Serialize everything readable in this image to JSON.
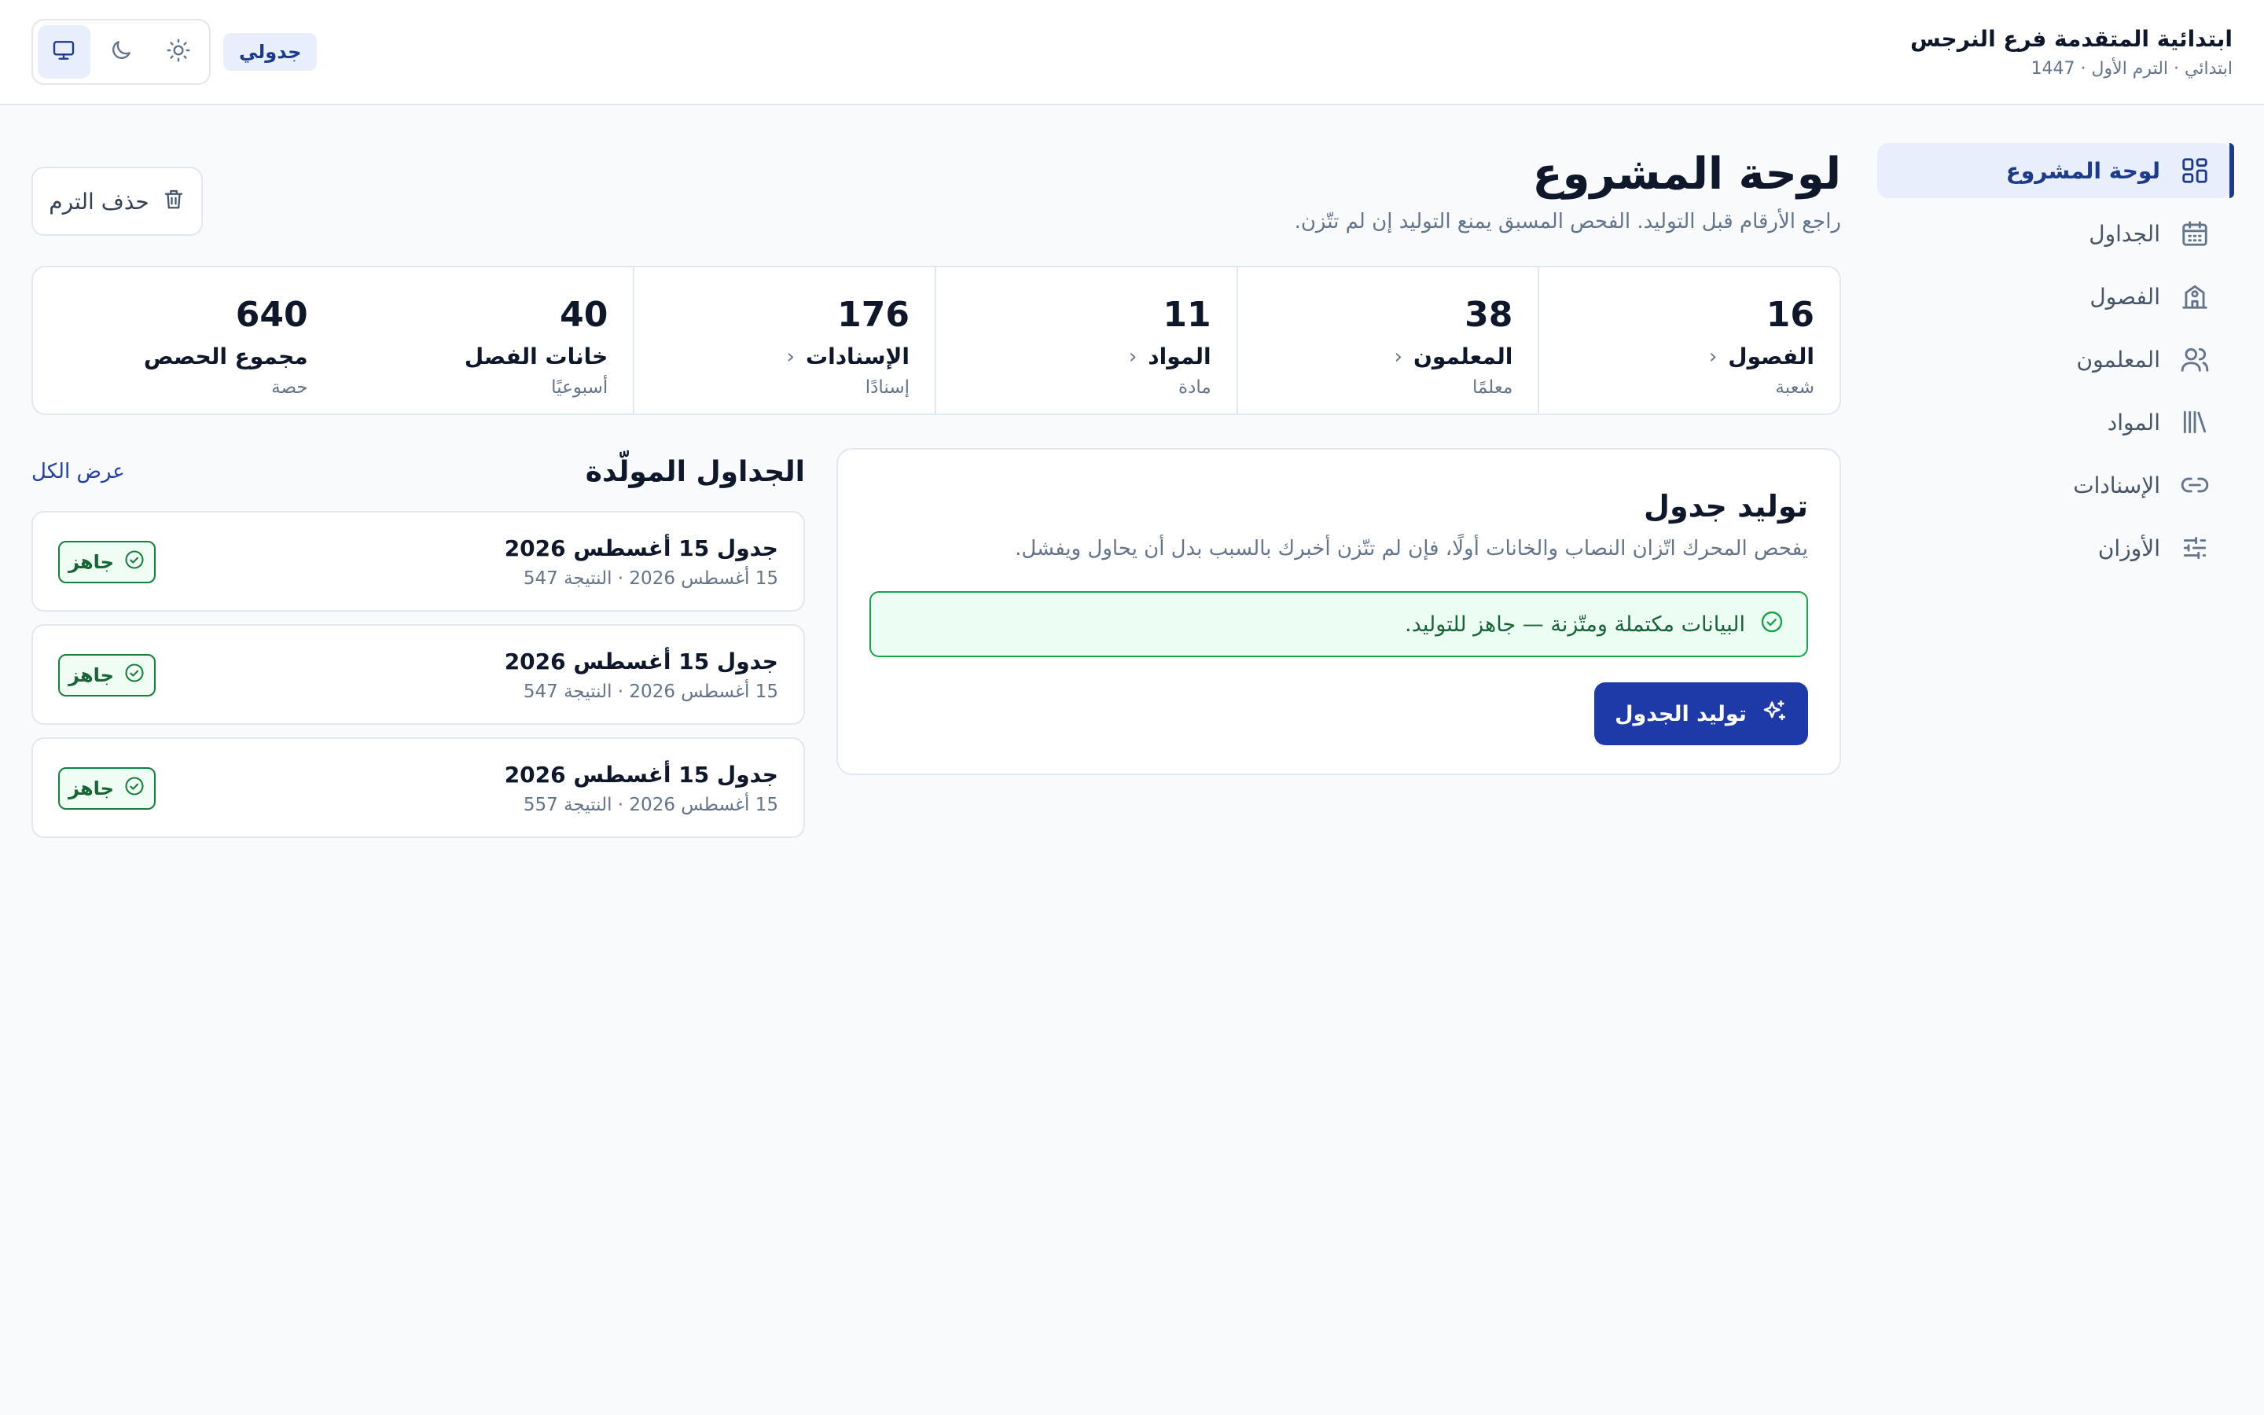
{
  "header": {
    "school_name": "ابتدائية المتقدمة فرع النرجس",
    "school_sub": "ابتدائي · الترم الأول · 1447",
    "app_chip": "جدولي",
    "theme_options": [
      "system-icon",
      "moon-icon",
      "sun-icon"
    ]
  },
  "sidebar": {
    "items": [
      {
        "label": "لوحة المشروع",
        "icon": "dashboard-icon",
        "active": true
      },
      {
        "label": "الجداول",
        "icon": "calendar-icon"
      },
      {
        "label": "الفصول",
        "icon": "school-icon"
      },
      {
        "label": "المعلمون",
        "icon": "users-icon"
      },
      {
        "label": "المواد",
        "icon": "books-icon"
      },
      {
        "label": "الإسنادات",
        "icon": "link-icon"
      },
      {
        "label": "الأوزان",
        "icon": "sliders-icon"
      }
    ]
  },
  "page": {
    "title": "لوحة المشروع",
    "subtitle": "راجع الأرقام قبل التوليد. الفحص المسبق يمنع التوليد إن لم تتّزن.",
    "delete_label": "حذف الترم"
  },
  "stats": [
    {
      "value": "16",
      "label": "الفصول",
      "unit": "شعبة"
    },
    {
      "value": "38",
      "label": "المعلمون",
      "unit": "معلمًا"
    },
    {
      "value": "11",
      "label": "المواد",
      "unit": "مادة"
    },
    {
      "value": "176",
      "label": "الإسنادات",
      "unit": "إسنادًا"
    },
    {
      "value": "40",
      "label": "خانات الفصل",
      "unit": "أسبوعيًا"
    },
    {
      "value": "640",
      "label": "مجموع الحصص",
      "unit": "حصة"
    }
  ],
  "generate": {
    "title": "توليد جدول",
    "description": "يفحص المحرك اتّزان النصاب والخانات أولًا، فإن لم تتّزن أخبرك بالسبب بدل أن يحاول ويفشل.",
    "alert": "البيانات مكتملة ومتّزنة — جاهز للتوليد.",
    "button": "توليد الجدول"
  },
  "schedules": {
    "title": "الجداول المولّدة",
    "view_all": "عرض الكل",
    "items": [
      {
        "name": "جدول 15 أغسطس 2026",
        "meta": "15 أغسطس 2026 · النتيجة 547",
        "status": "جاهز"
      },
      {
        "name": "جدول 15 أغسطس 2026",
        "meta": "15 أغسطس 2026 · النتيجة 547",
        "status": "جاهز"
      },
      {
        "name": "جدول 15 أغسطس 2026",
        "meta": "15 أغسطس 2026 · النتيجة 557",
        "status": "جاهز"
      }
    ]
  },
  "colors": {
    "accent": "#1e3aa8",
    "success": "#16a34a",
    "background": "#f8fafc"
  }
}
